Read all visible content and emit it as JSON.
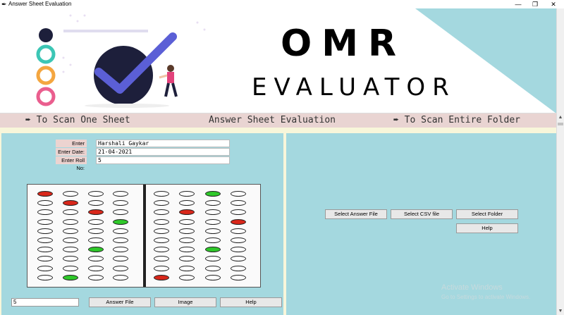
{
  "window": {
    "title": "Answer Sheet Evaluation",
    "controls": {
      "minimize": "—",
      "restore": "❐",
      "close": "✕"
    }
  },
  "banner": {
    "title": "OMR",
    "subtitle": "EVALUATOR",
    "accent_teal": "#a4d8df"
  },
  "nav": {
    "scan_one": "➨ To Scan One Sheet",
    "center": "Answer Sheet Evaluation",
    "scan_folder": "➨ To Scan Entire Folder"
  },
  "form": {
    "name_label": "Enter Name:",
    "name_value": "Harshali Gaykar",
    "date_label": "Enter Date:",
    "date_value": "21-04-2021",
    "roll_label": "Enter Roll No:",
    "roll_value": "5"
  },
  "omr": {
    "left_rows": [
      [
        "red",
        "",
        "",
        ""
      ],
      [
        "",
        "red",
        "",
        ""
      ],
      [
        "",
        "",
        "red",
        ""
      ],
      [
        "",
        "",
        "",
        "green"
      ],
      [
        "",
        "",
        "",
        ""
      ],
      [
        "",
        "",
        "",
        ""
      ],
      [
        "",
        "",
        "green",
        ""
      ],
      [
        "",
        "",
        "",
        ""
      ],
      [
        "",
        "",
        "",
        ""
      ],
      [
        "",
        "green",
        "",
        ""
      ]
    ],
    "right_rows": [
      [
        "",
        "",
        "green",
        ""
      ],
      [
        "",
        "",
        "",
        ""
      ],
      [
        "",
        "red",
        "",
        ""
      ],
      [
        "",
        "",
        "",
        "red"
      ],
      [
        "",
        "",
        "",
        ""
      ],
      [
        "",
        "",
        "",
        ""
      ],
      [
        "",
        "",
        "green",
        ""
      ],
      [
        "",
        "",
        "",
        ""
      ],
      [
        "",
        "",
        "",
        ""
      ],
      [
        "red",
        "",
        "",
        ""
      ]
    ]
  },
  "bottom": {
    "count_value": "5",
    "answer_file": "Answer File",
    "image": "Image",
    "help": "Help"
  },
  "right_panel": {
    "select_answer_file": "Select Answer File",
    "select_csv": "Select CSV file",
    "select_folder": "Select Folder",
    "help": "Help"
  },
  "watermark": {
    "line1": "Activate Windows",
    "line2": "Go to Settings to activate Windows."
  },
  "colors": {
    "background": "#f8f6da",
    "panel": "#a4d8df",
    "nav_strip": "#e9d4d2",
    "bubble_red": "#d9271a",
    "bubble_green": "#2fc92a"
  }
}
